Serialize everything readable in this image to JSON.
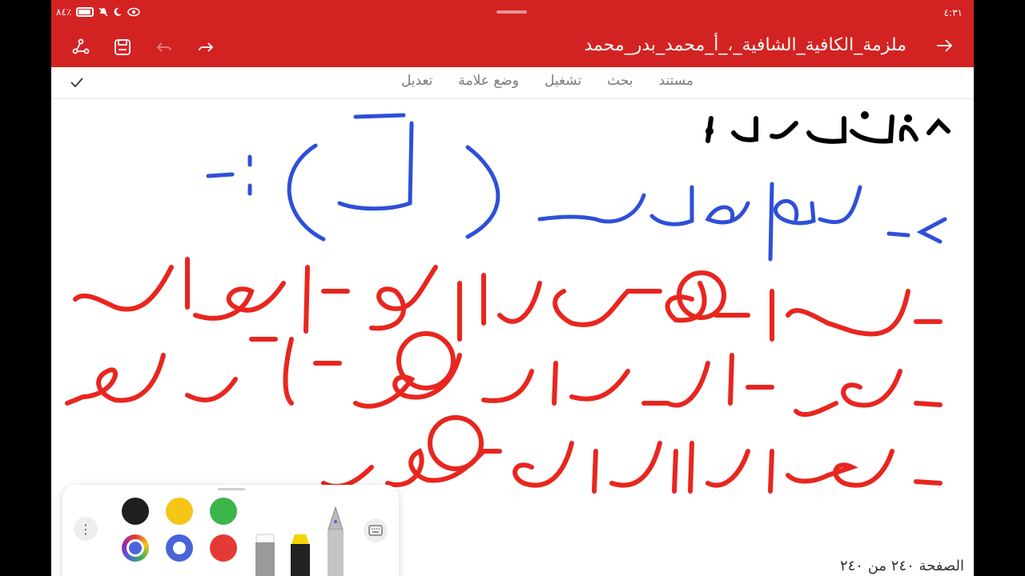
{
  "status": {
    "time": "٤:٣١",
    "battery": "٨٤٪"
  },
  "appbar": {
    "title": "ملزمة_الكافية_الشافية_،_أ_محمد_بدر_محمد"
  },
  "menu": {
    "items": [
      "مستند",
      "بحث",
      "تشغيل",
      "وضع علامة",
      "تعديل"
    ]
  },
  "page_indicator": "الصفحة ٢٤٠ من ٢٤٠",
  "palette": {
    "colors": [
      "#1f1f1f",
      "#f5c518",
      "#3cb54a",
      "#4a64d8",
      "#e53935"
    ],
    "tools": [
      "eraser",
      "highlighter",
      "fountain-pen"
    ]
  },
  "ink": {
    "heading_color": "#000000",
    "blue": "#2f4fd8",
    "red": "#e8261f"
  }
}
